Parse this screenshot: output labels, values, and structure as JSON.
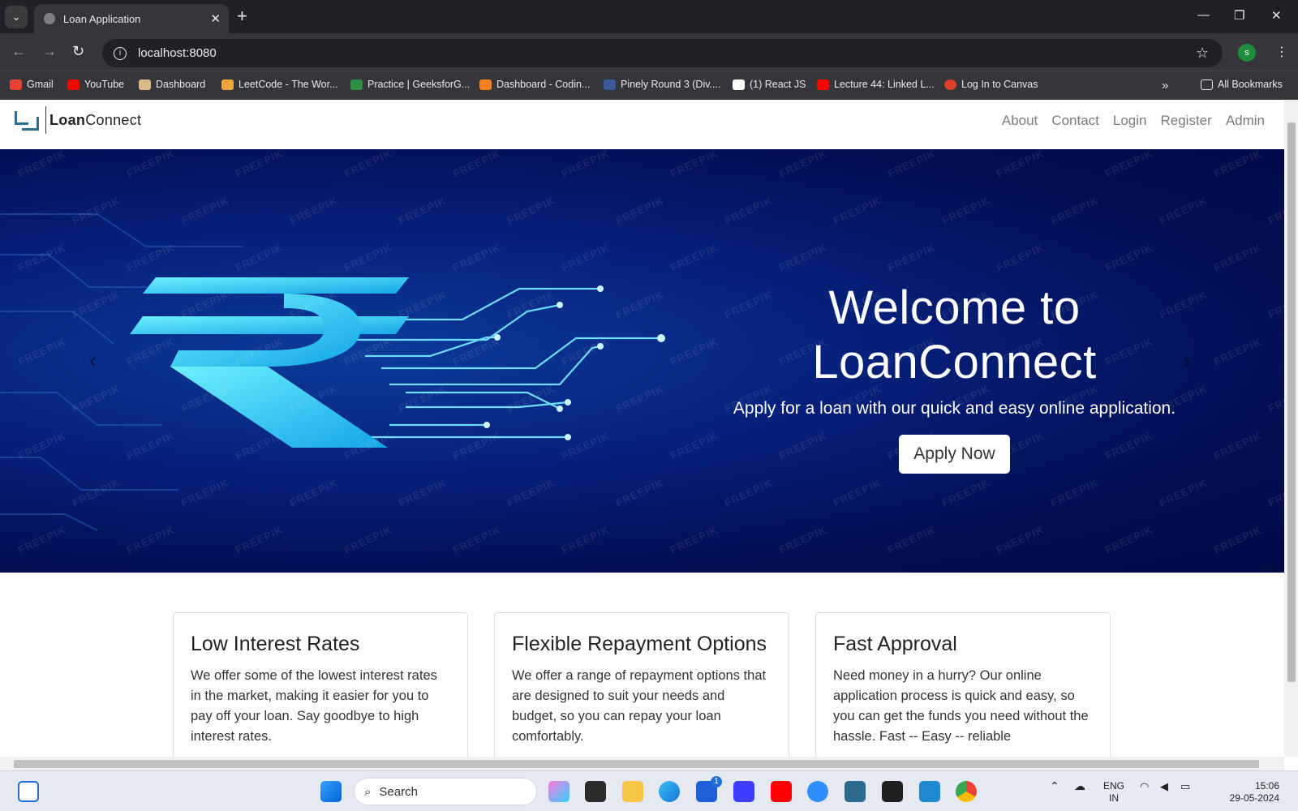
{
  "browser": {
    "tab_title": "Loan Application",
    "url": "localhost:8080",
    "profile_initial": "s",
    "bookmarks": [
      "Gmail",
      "YouTube",
      "Dashboard",
      "LeetCode - The Wor...",
      "Practice | GeeksforG...",
      "Dashboard - Codin...",
      "Pinely Round 3 (Div....",
      "(1) React JS",
      "Lecture 44: Linked L...",
      "Log In to Canvas"
    ],
    "all_bookmarks": "All Bookmarks"
  },
  "site": {
    "logo_bold": "Loan",
    "logo_rest": "Connect",
    "nav": [
      "About",
      "Contact",
      "Login",
      "Register",
      "Admin"
    ],
    "watermark": "FREEPIK"
  },
  "hero": {
    "title": "Welcome to LoanConnect",
    "subtitle": "Apply for a loan with our quick and easy online application.",
    "button": "Apply Now",
    "rupee": "₹"
  },
  "features": [
    {
      "title": "Low Interest Rates",
      "text": "We offer some of the lowest interest rates in the market, making it easier for you to pay off your loan. Say goodbye to high interest rates."
    },
    {
      "title": "Flexible Repayment Options",
      "text": "We offer a range of repayment options that are designed to suit your needs and budget, so you can repay your loan comfortably."
    },
    {
      "title": "Fast Approval",
      "text": "Need money in a hurry? Our online application process is quick and easy, so you can get the funds you need without the hassle. Fast -- Easy -- reliable"
    }
  ],
  "taskbar": {
    "search": "Search",
    "lang1": "ENG",
    "lang2": "IN",
    "time": "15:06",
    "date": "29-05-2024",
    "badge": "1"
  }
}
